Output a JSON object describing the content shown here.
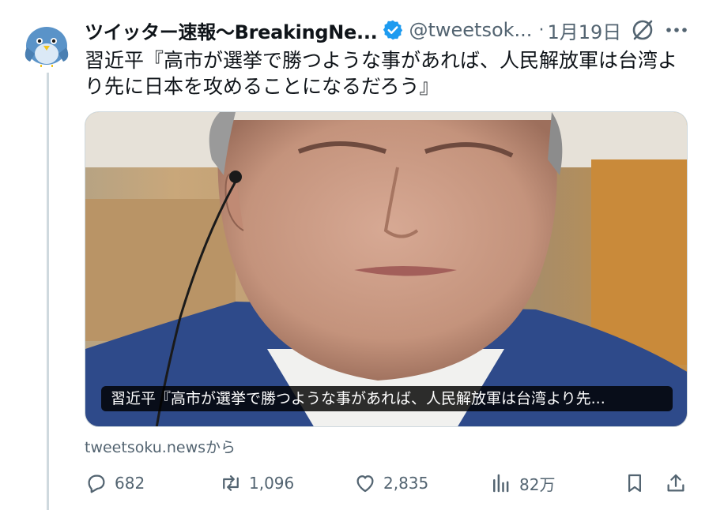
{
  "tweet": {
    "display_name": "ツイッター速報〜BreakingNe...",
    "handle": "@tweetsok...",
    "separator": "·",
    "date": "1月19日",
    "text": "習近平『高市が選挙で勝つような事があれば、人民解放軍は台湾より先に日本を攻めることになるだろう』",
    "media_caption": "習近平『高市が選挙で勝つような事があれば、人民解放軍は台湾より先...",
    "source": "tweetsoku.newsから"
  },
  "actions": {
    "replies": "682",
    "retweets": "1,096",
    "likes": "2,835",
    "views": "82万"
  },
  "icons": [
    "verified-badge-icon",
    "grok-icon",
    "more-icon",
    "reply-icon",
    "retweet-icon",
    "like-icon",
    "views-icon",
    "bookmark-icon",
    "share-icon"
  ],
  "colors": {
    "verified_blue": "#1d9bf0",
    "secondary_text": "#536471",
    "primary_text": "#0f1419"
  }
}
